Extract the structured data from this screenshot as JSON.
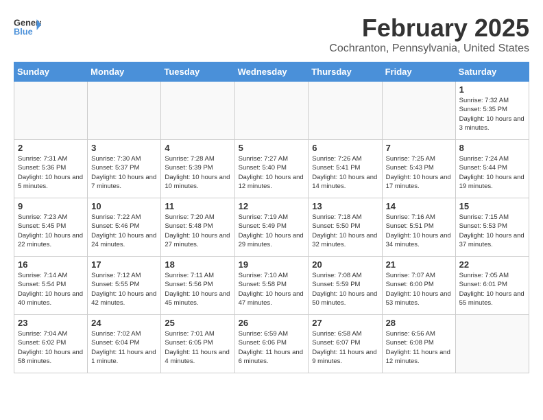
{
  "header": {
    "logo_general": "General",
    "logo_blue": "Blue",
    "month_title": "February 2025",
    "location": "Cochranton, Pennsylvania, United States"
  },
  "weekdays": [
    "Sunday",
    "Monday",
    "Tuesday",
    "Wednesday",
    "Thursday",
    "Friday",
    "Saturday"
  ],
  "weeks": [
    [
      {
        "day": "",
        "info": ""
      },
      {
        "day": "",
        "info": ""
      },
      {
        "day": "",
        "info": ""
      },
      {
        "day": "",
        "info": ""
      },
      {
        "day": "",
        "info": ""
      },
      {
        "day": "",
        "info": ""
      },
      {
        "day": "1",
        "info": "Sunrise: 7:32 AM\nSunset: 5:35 PM\nDaylight: 10 hours and 3 minutes."
      }
    ],
    [
      {
        "day": "2",
        "info": "Sunrise: 7:31 AM\nSunset: 5:36 PM\nDaylight: 10 hours and 5 minutes."
      },
      {
        "day": "3",
        "info": "Sunrise: 7:30 AM\nSunset: 5:37 PM\nDaylight: 10 hours and 7 minutes."
      },
      {
        "day": "4",
        "info": "Sunrise: 7:28 AM\nSunset: 5:39 PM\nDaylight: 10 hours and 10 minutes."
      },
      {
        "day": "5",
        "info": "Sunrise: 7:27 AM\nSunset: 5:40 PM\nDaylight: 10 hours and 12 minutes."
      },
      {
        "day": "6",
        "info": "Sunrise: 7:26 AM\nSunset: 5:41 PM\nDaylight: 10 hours and 14 minutes."
      },
      {
        "day": "7",
        "info": "Sunrise: 7:25 AM\nSunset: 5:43 PM\nDaylight: 10 hours and 17 minutes."
      },
      {
        "day": "8",
        "info": "Sunrise: 7:24 AM\nSunset: 5:44 PM\nDaylight: 10 hours and 19 minutes."
      }
    ],
    [
      {
        "day": "9",
        "info": "Sunrise: 7:23 AM\nSunset: 5:45 PM\nDaylight: 10 hours and 22 minutes."
      },
      {
        "day": "10",
        "info": "Sunrise: 7:22 AM\nSunset: 5:46 PM\nDaylight: 10 hours and 24 minutes."
      },
      {
        "day": "11",
        "info": "Sunrise: 7:20 AM\nSunset: 5:48 PM\nDaylight: 10 hours and 27 minutes."
      },
      {
        "day": "12",
        "info": "Sunrise: 7:19 AM\nSunset: 5:49 PM\nDaylight: 10 hours and 29 minutes."
      },
      {
        "day": "13",
        "info": "Sunrise: 7:18 AM\nSunset: 5:50 PM\nDaylight: 10 hours and 32 minutes."
      },
      {
        "day": "14",
        "info": "Sunrise: 7:16 AM\nSunset: 5:51 PM\nDaylight: 10 hours and 34 minutes."
      },
      {
        "day": "15",
        "info": "Sunrise: 7:15 AM\nSunset: 5:53 PM\nDaylight: 10 hours and 37 minutes."
      }
    ],
    [
      {
        "day": "16",
        "info": "Sunrise: 7:14 AM\nSunset: 5:54 PM\nDaylight: 10 hours and 40 minutes."
      },
      {
        "day": "17",
        "info": "Sunrise: 7:12 AM\nSunset: 5:55 PM\nDaylight: 10 hours and 42 minutes."
      },
      {
        "day": "18",
        "info": "Sunrise: 7:11 AM\nSunset: 5:56 PM\nDaylight: 10 hours and 45 minutes."
      },
      {
        "day": "19",
        "info": "Sunrise: 7:10 AM\nSunset: 5:58 PM\nDaylight: 10 hours and 47 minutes."
      },
      {
        "day": "20",
        "info": "Sunrise: 7:08 AM\nSunset: 5:59 PM\nDaylight: 10 hours and 50 minutes."
      },
      {
        "day": "21",
        "info": "Sunrise: 7:07 AM\nSunset: 6:00 PM\nDaylight: 10 hours and 53 minutes."
      },
      {
        "day": "22",
        "info": "Sunrise: 7:05 AM\nSunset: 6:01 PM\nDaylight: 10 hours and 55 minutes."
      }
    ],
    [
      {
        "day": "23",
        "info": "Sunrise: 7:04 AM\nSunset: 6:02 PM\nDaylight: 10 hours and 58 minutes."
      },
      {
        "day": "24",
        "info": "Sunrise: 7:02 AM\nSunset: 6:04 PM\nDaylight: 11 hours and 1 minute."
      },
      {
        "day": "25",
        "info": "Sunrise: 7:01 AM\nSunset: 6:05 PM\nDaylight: 11 hours and 4 minutes."
      },
      {
        "day": "26",
        "info": "Sunrise: 6:59 AM\nSunset: 6:06 PM\nDaylight: 11 hours and 6 minutes."
      },
      {
        "day": "27",
        "info": "Sunrise: 6:58 AM\nSunset: 6:07 PM\nDaylight: 11 hours and 9 minutes."
      },
      {
        "day": "28",
        "info": "Sunrise: 6:56 AM\nSunset: 6:08 PM\nDaylight: 11 hours and 12 minutes."
      },
      {
        "day": "",
        "info": ""
      }
    ]
  ]
}
